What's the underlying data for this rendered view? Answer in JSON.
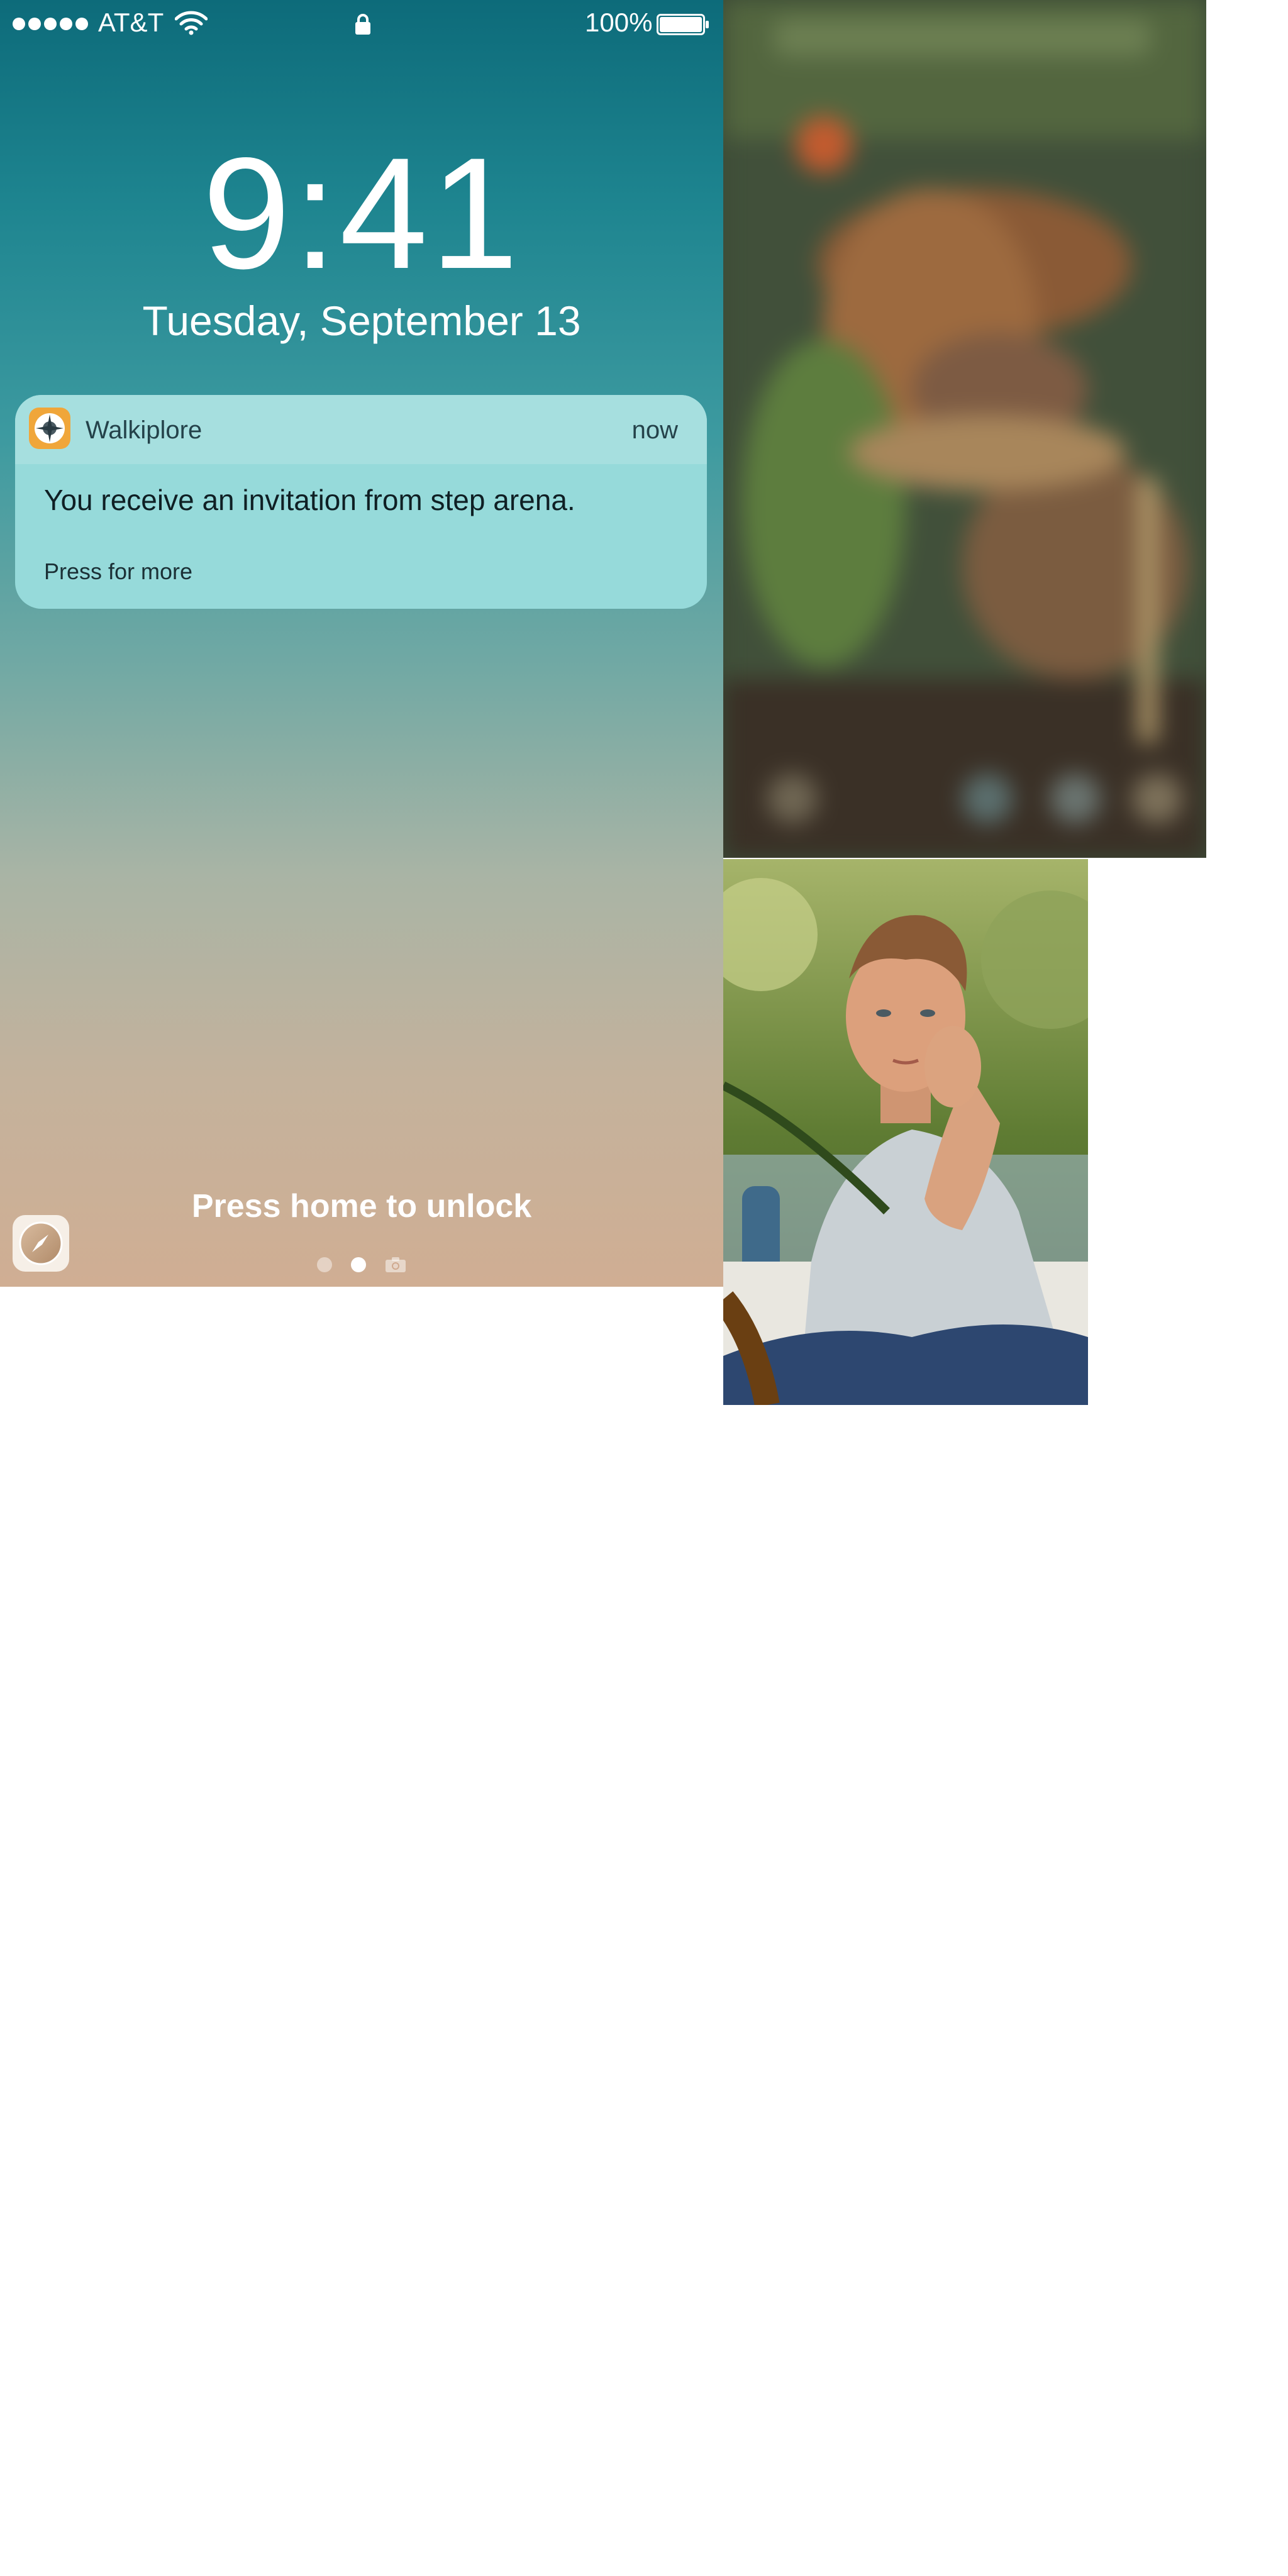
{
  "status_bar": {
    "carrier": "AT&T",
    "battery_percent": "100%",
    "signal_bars": 5,
    "icons": [
      "signal-dots-icon",
      "wifi-icon",
      "lock-icon",
      "battery-icon"
    ]
  },
  "lock_screen": {
    "time": "9:41",
    "date": "Tuesday, September 13",
    "unlock_hint": "Press home to unlock",
    "page_indicator": {
      "pages": 3,
      "active_index": 1,
      "last_is_camera": true
    }
  },
  "notification": {
    "app_name": "Walkiplore",
    "timestamp": "now",
    "message": "You receive an invitation from step arena.",
    "action_hint": "Press for more",
    "app_icon": "compass-icon",
    "app_icon_color": "#f0a63a"
  },
  "dock": {
    "bottom_left_app_icon": "compass-app-icon"
  },
  "colors": {
    "gradient_top": "#0d6b7a",
    "gradient_bottom": "#d0ae93",
    "notification_bg": "#96dada"
  }
}
